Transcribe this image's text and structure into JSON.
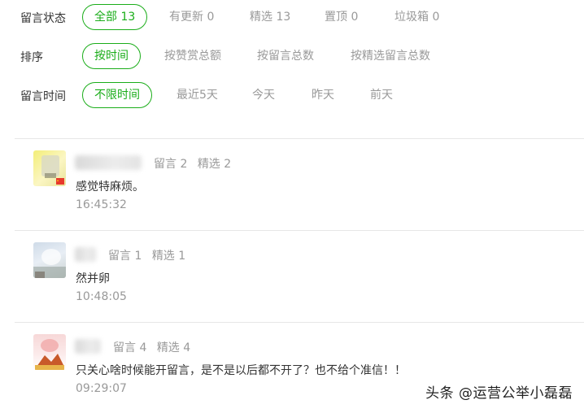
{
  "filters": {
    "status": {
      "label": "留言状态",
      "options": [
        "全部 13",
        "有更新 0",
        "精选 13",
        "置顶 0",
        "垃圾箱 0"
      ]
    },
    "sort": {
      "label": "排序",
      "options": [
        "按时间",
        "按赞赏总额",
        "按留言总数",
        "按精选留言总数"
      ]
    },
    "time": {
      "label": "留言时间",
      "options": [
        "不限时间",
        "最近5天",
        "今天",
        "昨天",
        "前天"
      ]
    }
  },
  "comments": [
    {
      "meta": [
        "留言 2",
        "精选 2"
      ],
      "content": "感觉特麻烦。",
      "time": "16:45:32"
    },
    {
      "meta": [
        "留言 1",
        "精选 1"
      ],
      "content": "然并卵",
      "time": "10:48:05"
    },
    {
      "meta": [
        "留言 4",
        "精选 4"
      ],
      "content": "只关心啥时候能开留言，是不是以后都不开了？也不给个准信！！",
      "time": "09:29:07"
    }
  ],
  "watermark": "头条 @运营公举小磊磊",
  "colors": {
    "accent": "#1aad19",
    "muted": "#999999",
    "text": "#333333"
  }
}
